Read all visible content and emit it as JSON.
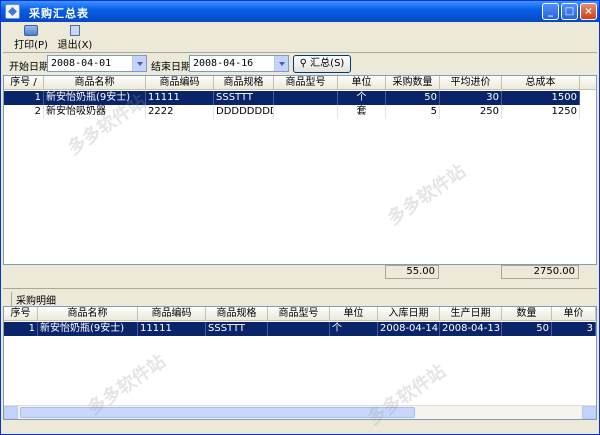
{
  "window": {
    "title": "采购汇总表",
    "controls": {
      "minimize": "_",
      "maximize": "□",
      "close": "×"
    }
  },
  "toolbar": {
    "print_label": "打印(P)",
    "exit_label": "退出(X)"
  },
  "filter": {
    "start_label": "开始日期",
    "start_value": "2008-04-01",
    "end_label": "结束日期",
    "end_value": "2008-04-16",
    "sum_button_label": "汇总(S)"
  },
  "summary": {
    "columns": [
      "序号",
      "商品名称",
      "商品编码",
      "商品规格",
      "商品型号",
      "单位",
      "采购数量",
      "平均进价",
      "总成本"
    ],
    "sort_indicator": "/",
    "rows": [
      {
        "no": "1",
        "name": "新安怡奶瓶(9安士)",
        "code": "11111",
        "spec": "SSSTTT",
        "model": "",
        "unit": "个",
        "qty": "50",
        "avg_price": "30",
        "total": "1500"
      },
      {
        "no": "2",
        "name": "新安怡吸奶器",
        "code": "2222",
        "spec": "DDDDDDDDDD",
        "model": "",
        "unit": "套",
        "qty": "5",
        "avg_price": "250",
        "total": "1250"
      }
    ],
    "totals": {
      "qty": "55.00",
      "total": "2750.00"
    }
  },
  "detail": {
    "section_label": "采购明细",
    "columns": [
      "序号",
      "商品名称",
      "商品编码",
      "商品规格",
      "商品型号",
      "单位",
      "入库日期",
      "生产日期",
      "数量",
      "单价"
    ],
    "rows": [
      {
        "no": "1",
        "name": "新安怡奶瓶(9安士)",
        "code": "11111",
        "spec": "SSSTTT",
        "model": "",
        "unit": "个",
        "in_date": "2008-04-14",
        "prod_date": "2008-04-13",
        "qty": "50",
        "price": "3"
      }
    ]
  },
  "watermark": "多多软件站"
}
